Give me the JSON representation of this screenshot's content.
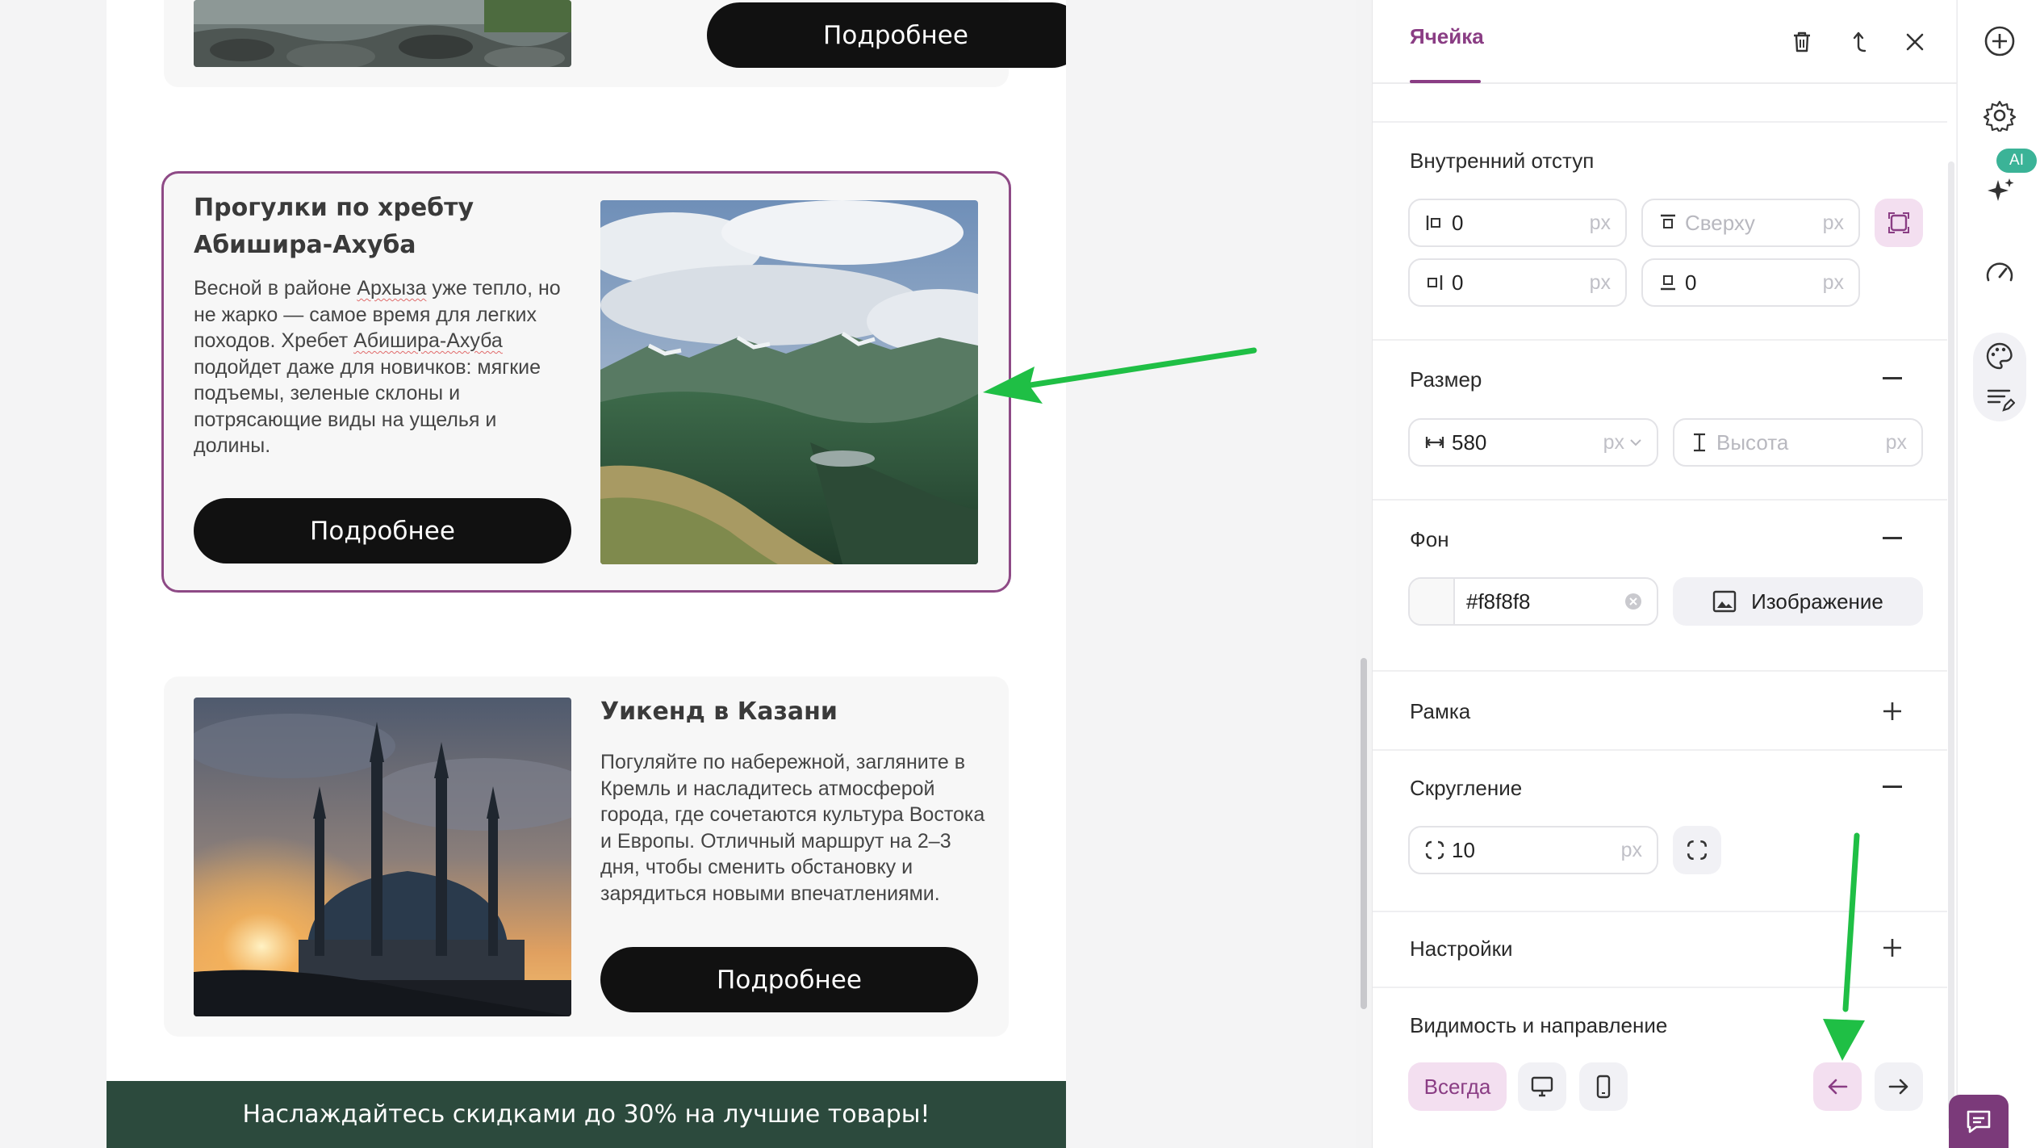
{
  "email": {
    "card_top": {
      "button": "Подробнее"
    },
    "card_selected": {
      "title": "Прогулки по хребту Абишира-Ахуба",
      "text_parts": [
        "Весной в районе ",
        "Архыза",
        " уже тепло, но не жарко — самое время для легких походов. Хребет ",
        "Абишира-Ахуба",
        " подойдет даже для новичков: мягкие подъемы, зеленые склоны и потрясающие виды на ущелья и долины."
      ],
      "button": "Подробнее",
      "image": "mountain-ridge-photo"
    },
    "card_kazan": {
      "title": "Уикенд в Казани",
      "text": "Погуляйте по набережной, загляните в Кремль и насладитесь атмосферой города, где сочетаются культура Востока и Европы. Отличный маршрут на 2–3 дня, чтобы сменить обстановку и зарядиться новыми впечатлениями.",
      "button": "Подробнее",
      "image": "kazan-mosque-sunset-photo"
    },
    "promo": "Наслаждайтесь скидками до 30% на лучшие товары!"
  },
  "panel": {
    "tab": "Ячейка",
    "padding": {
      "title": "Внутренний отступ",
      "left": "0",
      "top_placeholder": "Сверху",
      "right": "0",
      "bottom": "0",
      "unit": "px"
    },
    "size": {
      "title": "Размер",
      "width": "580",
      "width_unit": "px",
      "height_placeholder": "Высота",
      "unit": "px"
    },
    "background": {
      "title": "Фон",
      "color": "#f8f8f8",
      "image_button": "Изображение"
    },
    "border": {
      "title": "Рамка"
    },
    "radius": {
      "title": "Скругление",
      "value": "10",
      "unit": "px"
    },
    "settings": {
      "title": "Настройки"
    },
    "visibility": {
      "title": "Видимость и направление",
      "always": "Всегда"
    }
  },
  "rail": {
    "ai_badge": "AI"
  },
  "colors": {
    "accent": "#8a3d84",
    "accent_bg": "#f3dff0",
    "dark_button": "#111111",
    "promo_bg": "#2c4a3d",
    "annotation_arrow": "#1fbf45"
  }
}
